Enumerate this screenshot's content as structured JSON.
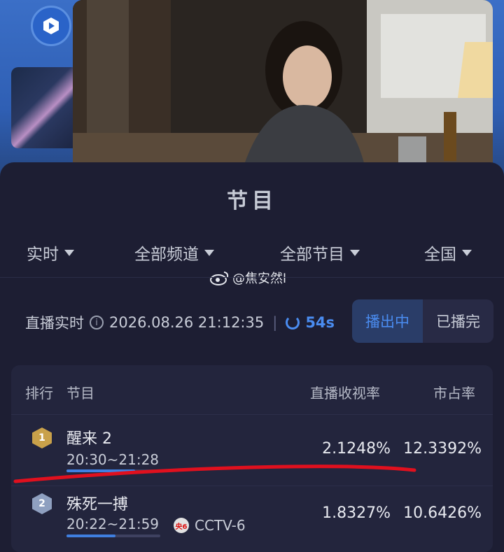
{
  "header": {
    "section_title": "节目"
  },
  "filters": [
    {
      "label": "实时"
    },
    {
      "label": "全部频道"
    },
    {
      "label": "全部节目"
    },
    {
      "label": "全国"
    }
  ],
  "watermark": "@焦安然l",
  "status": {
    "label": "直播实时",
    "datetime": "2026.08.26 21:12:35",
    "countdown": "54s"
  },
  "toggle": {
    "live": "播出中",
    "ended": "已播完"
  },
  "table": {
    "headers": {
      "rank": "排行",
      "program": "节目",
      "rating": "直播收视率",
      "share": "市占率"
    },
    "rows": [
      {
        "rank": "1",
        "name": "醒来 2",
        "time": "20:30~21:28",
        "rating": "2.1248%",
        "share": "12.3392%",
        "progress": 0.73
      },
      {
        "rank": "2",
        "name": "殊死一搏",
        "time": "20:22~21:59",
        "rating": "1.8327%",
        "share": "10.6426%",
        "progress": 0.52,
        "channel_badge": "央6",
        "channel": "CCTV-6"
      }
    ]
  },
  "colors": {
    "accent": "#4a8cf0",
    "rank1": "#c9a14a",
    "rank2": "#8fa0c0",
    "annotation": "#e0101e"
  }
}
